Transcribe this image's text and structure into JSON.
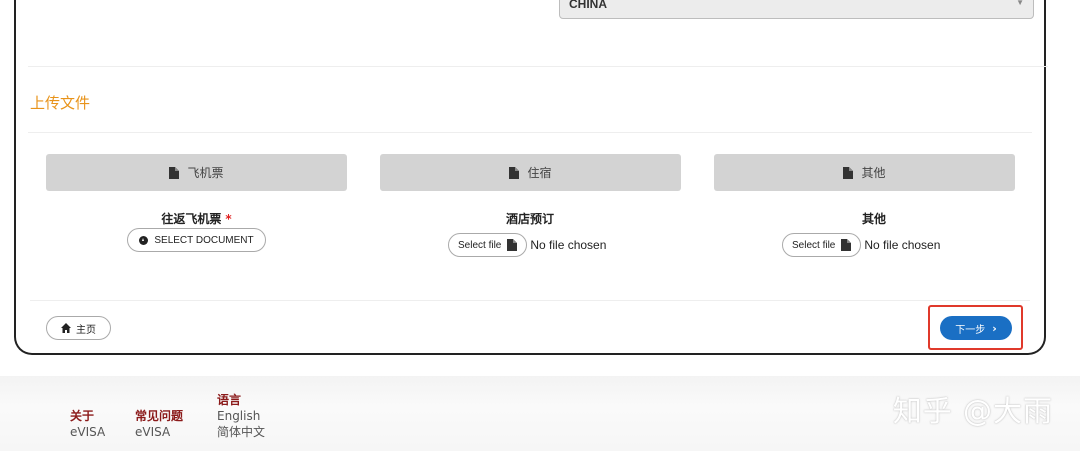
{
  "form": {
    "country_value": "CHINA",
    "upload_section_title": "上传文件",
    "tabs": [
      {
        "label": "飞机票"
      },
      {
        "label": "住宿"
      },
      {
        "label": "其他"
      }
    ],
    "fields": [
      {
        "label": "往返飞机票",
        "required_mark": "*",
        "button_label": "SELECT DOCUMENT"
      },
      {
        "label": "酒店预订",
        "button_label": "Select file",
        "status": "No file chosen"
      },
      {
        "label": "其他",
        "button_label": "Select file",
        "status": "No file chosen"
      }
    ],
    "home_label": "主页",
    "next_label": "下一步",
    "next_chevron": "›"
  },
  "footer": {
    "about": {
      "title": "关于",
      "item": "eVISA"
    },
    "faq": {
      "title": "常见问题",
      "item": "eVISA"
    },
    "language": {
      "title": "语言",
      "items": [
        "English",
        "简体中文"
      ]
    }
  },
  "watermark": "知乎 @大雨",
  "colors": {
    "accent": "#e8931a",
    "primary": "#1a6fc4",
    "highlight": "#e0392b",
    "footer_heading": "#8b1a1a"
  }
}
